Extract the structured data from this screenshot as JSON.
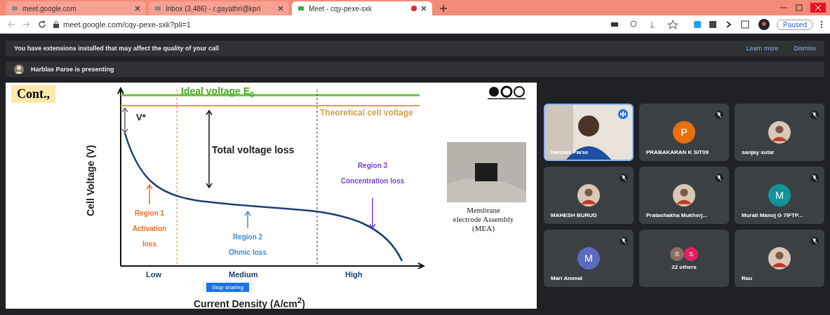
{
  "browser": {
    "tabs": [
      {
        "title": "meet.google.com",
        "selected": false,
        "recording": false
      },
      {
        "title": "Inbox (3,486) - r.gayathri@kpri",
        "selected": false,
        "recording": false
      },
      {
        "title": "Meet - cqy-pexe-sxk",
        "selected": true,
        "recording": true
      }
    ],
    "address": "meet.google.com/cqy-pexe-sxk?pli=1",
    "profile": "Paused"
  },
  "banner": {
    "message": "You have extensions installed that may affect the quality of your call",
    "actions": [
      "Learn more",
      "Dismiss"
    ]
  },
  "presenting": "Harblas Parse is presenting",
  "slide": {
    "heading": "Cont.,",
    "ideal": "Ideal voltage E$_{0}$",
    "theoretical": "Theoretical cell voltage",
    "v_star": "V*",
    "total_loss": "Total voltage loss",
    "y_label": "Cell Voltage (V)",
    "x_label": "Current Density (A/cm$^{2}$)",
    "regions": [
      {
        "name": "Region 1",
        "loss": "Activation loss",
        "color": "#e8732a"
      },
      {
        "name": "Region 2",
        "loss": "Ohmic loss",
        "color": "#3a8fd8"
      },
      {
        "name": "Region 3",
        "loss": "Concentration loss",
        "color": "#7b3fd6"
      }
    ],
    "ticks": [
      "Low",
      "Medium",
      "High"
    ],
    "mea_caption": "Membrane electrode Assembly (MEA)",
    "share_button": "Stop sharing"
  },
  "tiles": [
    {
      "kind": "video",
      "name": "Harblas Parse",
      "muted": false,
      "speaking": true
    },
    {
      "kind": "initial",
      "name": "PRABAKARAN K SIT09",
      "initial": "P",
      "color": "#e8710a",
      "muted": true,
      "speaking": false
    },
    {
      "name": "sanjay sutar",
      "muted": true,
      "speaking": false
    },
    {
      "name": "MAHESH BURUD",
      "muted": true,
      "speaking": false
    },
    {
      "name": "Pratashakha Mukherj...",
      "muted": true,
      "speaking": false
    },
    {
      "kind": "initial",
      "name": "Murali Manoj G 7IFTP...",
      "initial": "M",
      "color": "#12939a",
      "muted": true,
      "speaking": false
    },
    {
      "kind": "initial",
      "name": "Mari Ammal",
      "initial": "M",
      "color": "#5c6bc0",
      "muted": true,
      "speaking": false
    },
    {
      "kind": "others",
      "name": "22 others",
      "avatars": [
        {
          "initial": "S",
          "color": "#8d6e63"
        },
        {
          "initial": "S",
          "color": "#e91e63"
        }
      ],
      "muted": false,
      "speaking": false
    },
    {
      "name": "Rau",
      "muted": true,
      "speaking": false
    }
  ]
}
